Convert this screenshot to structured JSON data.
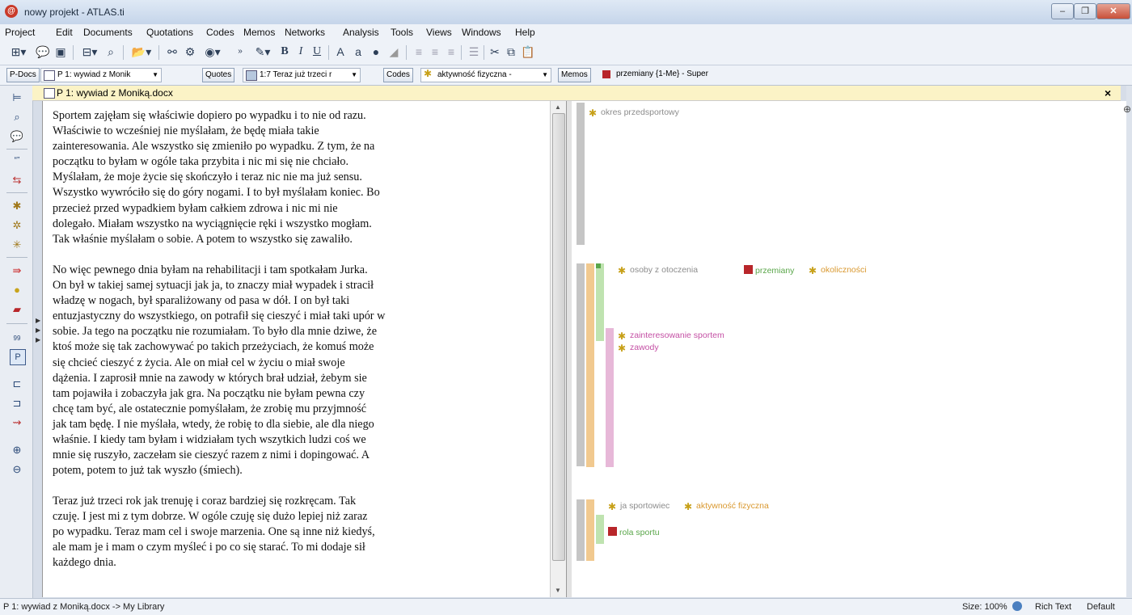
{
  "window": {
    "title": "nowy projekt - ATLAS.ti"
  },
  "menu": [
    "Project",
    "Edit",
    "Documents",
    "Quotations",
    "Codes",
    "Memos",
    "Networks",
    "Analysis",
    "Tools",
    "Views",
    "Windows",
    "Help"
  ],
  "selectors": {
    "pdocs_label": "P-Docs",
    "pdocs_value": "P 1: wywiad z Monik",
    "quotes_label": "Quotes",
    "quotes_value": "1:7 Teraz już trzeci r",
    "codes_label": "Codes",
    "codes_value": "aktywność fizyczna -",
    "memos_label": "Memos",
    "memos_value": "przemiany {1-Me} - Super"
  },
  "document": {
    "tab_title": "P 1: wywiad z Moniką.docx",
    "close": "×",
    "paragraphs": [
      [
        "Sportem zajęłam się właściwie dopiero po wypadku i to nie od razu.",
        "Właściwie to wcześniej nie myślałam, że będę miała takie",
        "zainteresowania. Ale wszystko się zmieniło po wypadku. Z tym, że na",
        "początku to byłam w ogóle taka przybita i nic mi się nie chciało.",
        "Myślałam, że moje życie się skończyło i teraz nic nie ma już sensu.",
        "Wszystko wywróciło się do góry nogami. I to był myślałam koniec. Bo",
        "przecież przed wypadkiem byłam całkiem zdrowa i nic mi nie",
        "dolegało. Miałam wszystko na wyciągnięcie ręki i wszystko mogłam.",
        "Tak właśnie myślałam o sobie. A potem to wszystko się zawaliło."
      ],
      [
        "No więc pewnego dnia byłam na rehabilitacji i tam spotkałam Jurka.",
        "On był w takiej samej sytuacji jak ja, to znaczy miał wypadek i stracił",
        "władzę w nogach, był sparaliżowany od pasa w dół. I on był taki",
        "entuzjastyczny do wszystkiego, on potrafił się cieszyć i miał taki upór w",
        "sobie. Ja tego na początku nie rozumiałam. To było dla mnie dziwe, że",
        "ktoś może się tak zachowywać po takich przeżyciach, że komuś może",
        "się chcieć cieszyć z życia. Ale on miał cel w życiu o miał swoje",
        "dążenia. I zaprosił mnie na zawody w których brał udział, żebym sie",
        "tam pojawiła i zobaczyła jak gra. Na początku nie byłam pewna czy",
        "chcę tam być, ale ostatecznie pomyślałam, że zrobię mu przyjmność",
        "jak tam będę. I nie myślała, wtedy, że robię to dla siebie, ale dla niego",
        "właśnie. I kiedy tam byłam i widziałam tych wszytkich ludzi coś we",
        "mnie się ruszyło, zaczełam sie cieszyć razem z nimi i dopingować. A",
        "potem, potem to już tak wyszło (śmiech)."
      ],
      [
        "Teraz już trzeci rok jak trenuję i coraz bardziej się rozkręcam. Tak",
        "czuję. I jest mi z tym dobrze. W ogóle czuję się dużo lepiej niż zaraz",
        "po wypadku. Teraz mam cel i swoje marzenia. One są inne niż kiedyś,",
        "ale mam je i mam o czym myśleć i po co się starać. To mi dodaje sił",
        "każdego dnia."
      ]
    ]
  },
  "margin_codes": {
    "okres": "okres przedsportowy",
    "osoby": "osoby z otoczenia",
    "przemiany": "przemiany",
    "okolicznosci": "okoliczności",
    "zainteresowanie": "zainteresowanie sportem",
    "zawody": "zawody",
    "ja_sportowiec": "ja sportowiec",
    "aktywnosc": "aktywność fizyczna",
    "rola": "rola sportu"
  },
  "colors": {
    "gray": "#8c8c8c",
    "green": "#5aa64a",
    "orange": "#d9982f",
    "pink": "#c44fa4",
    "memo_red": "#b8262a"
  },
  "status": {
    "path": "P 1: wywiad z Moniką.docx -> My Library",
    "size": "Size: 100%",
    "rich": "Rich Text",
    "default": "Default"
  }
}
